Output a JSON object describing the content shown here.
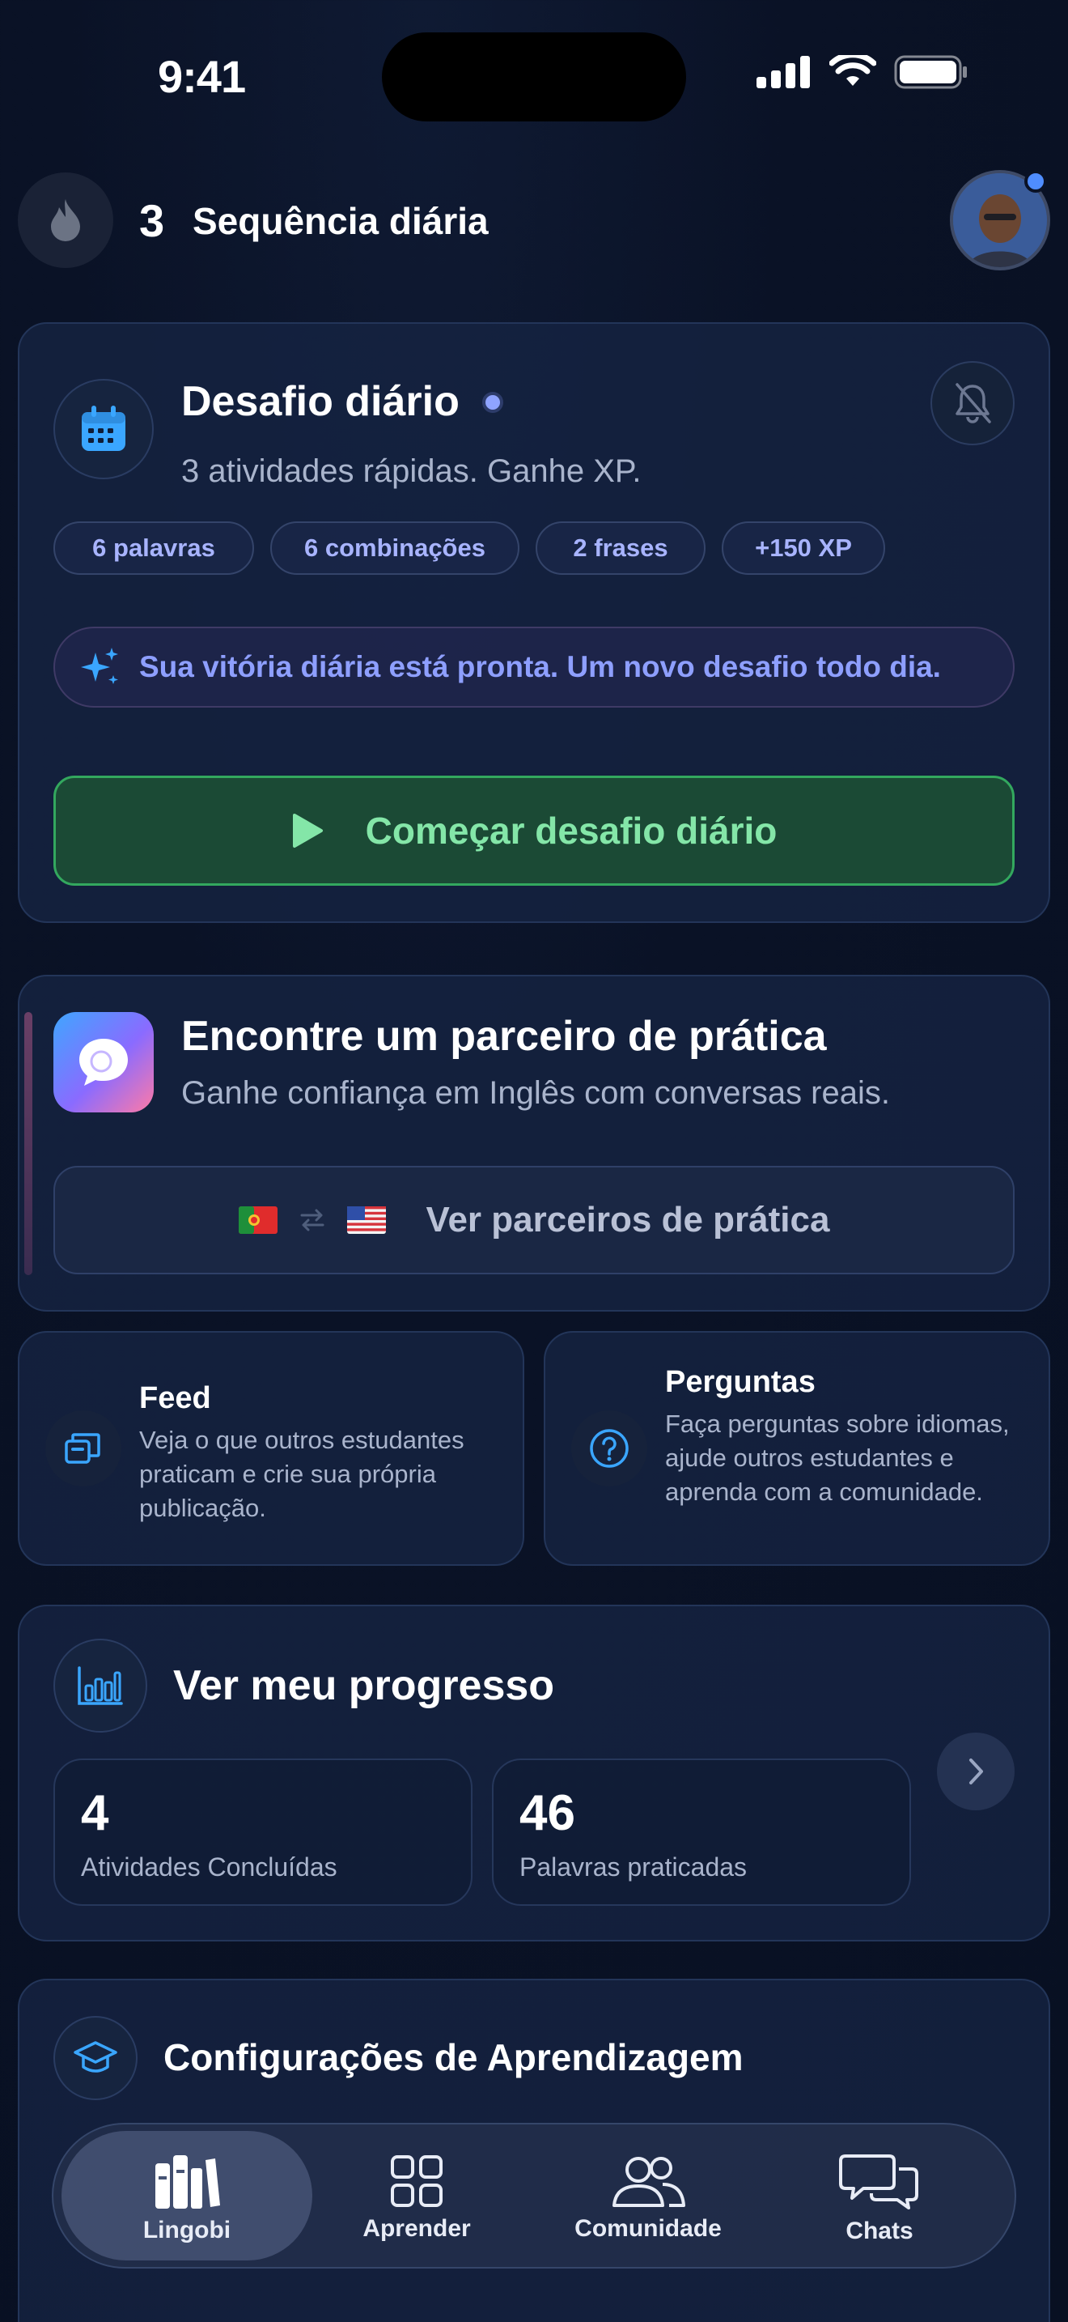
{
  "status_bar": {
    "time": "9:41"
  },
  "header": {
    "streak_count": "3",
    "streak_label": "Sequência diária"
  },
  "daily_challenge": {
    "title": "Desafio diário",
    "subtitle": "3 atividades rápidas. Ganhe XP.",
    "pills": [
      "6 palavras",
      "6 combinações",
      "2 frases",
      "+150 XP"
    ],
    "banner": "Sua vitória diária está pronta. Um novo desafio todo dia.",
    "start_button": "Começar desafio diário"
  },
  "practice_partner": {
    "title": "Encontre um parceiro de prática",
    "subtitle": "Ganhe confiança em Inglês com conversas reais.",
    "button": "Ver parceiros de prática"
  },
  "feed": {
    "title": "Feed",
    "desc": "Veja o que outros estudantes praticam e crie sua própria publicação."
  },
  "questions": {
    "title": "Perguntas",
    "desc": "Faça perguntas sobre idiomas, ajude outros estudantes e aprenda com a comunidade."
  },
  "progress": {
    "title": "Ver meu progresso",
    "stats": [
      {
        "value": "4",
        "label": "Atividades Concluídas"
      },
      {
        "value": "46",
        "label": "Palavras praticadas"
      }
    ]
  },
  "learning_settings": {
    "title": "Configurações de Aprendizagem"
  },
  "tabbar": {
    "tabs": [
      {
        "label": "Lingobi",
        "icon": "library-icon",
        "active": true
      },
      {
        "label": "Aprender",
        "icon": "grid-icon",
        "active": false
      },
      {
        "label": "Comunidade",
        "icon": "people-icon",
        "active": false
      },
      {
        "label": "Chats",
        "icon": "chat-bubbles-icon",
        "active": false
      }
    ]
  },
  "colors": {
    "accent_blue": "#8e9fff",
    "start_green": "#84e6a8",
    "icon_blue": "#3aa6ff"
  }
}
